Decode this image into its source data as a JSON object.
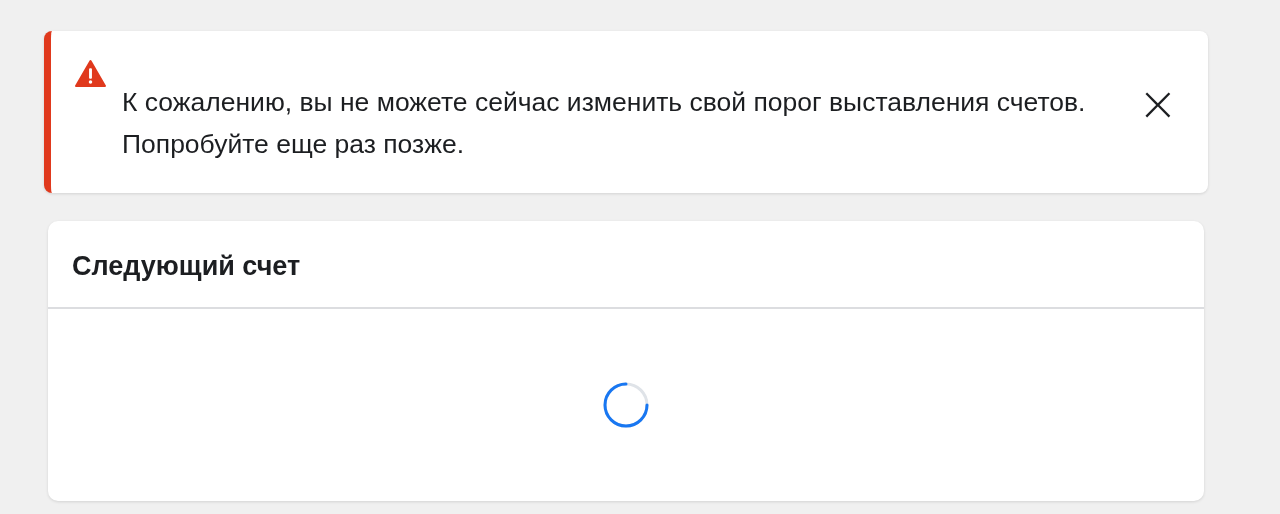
{
  "alert": {
    "message": "К сожалению, вы не можете сейчас изменить свой порог выставления счетов. Попробуйте еще раз позже.",
    "close": "×"
  },
  "next_invoice": {
    "title": "Следующий счет",
    "loading": true
  }
}
